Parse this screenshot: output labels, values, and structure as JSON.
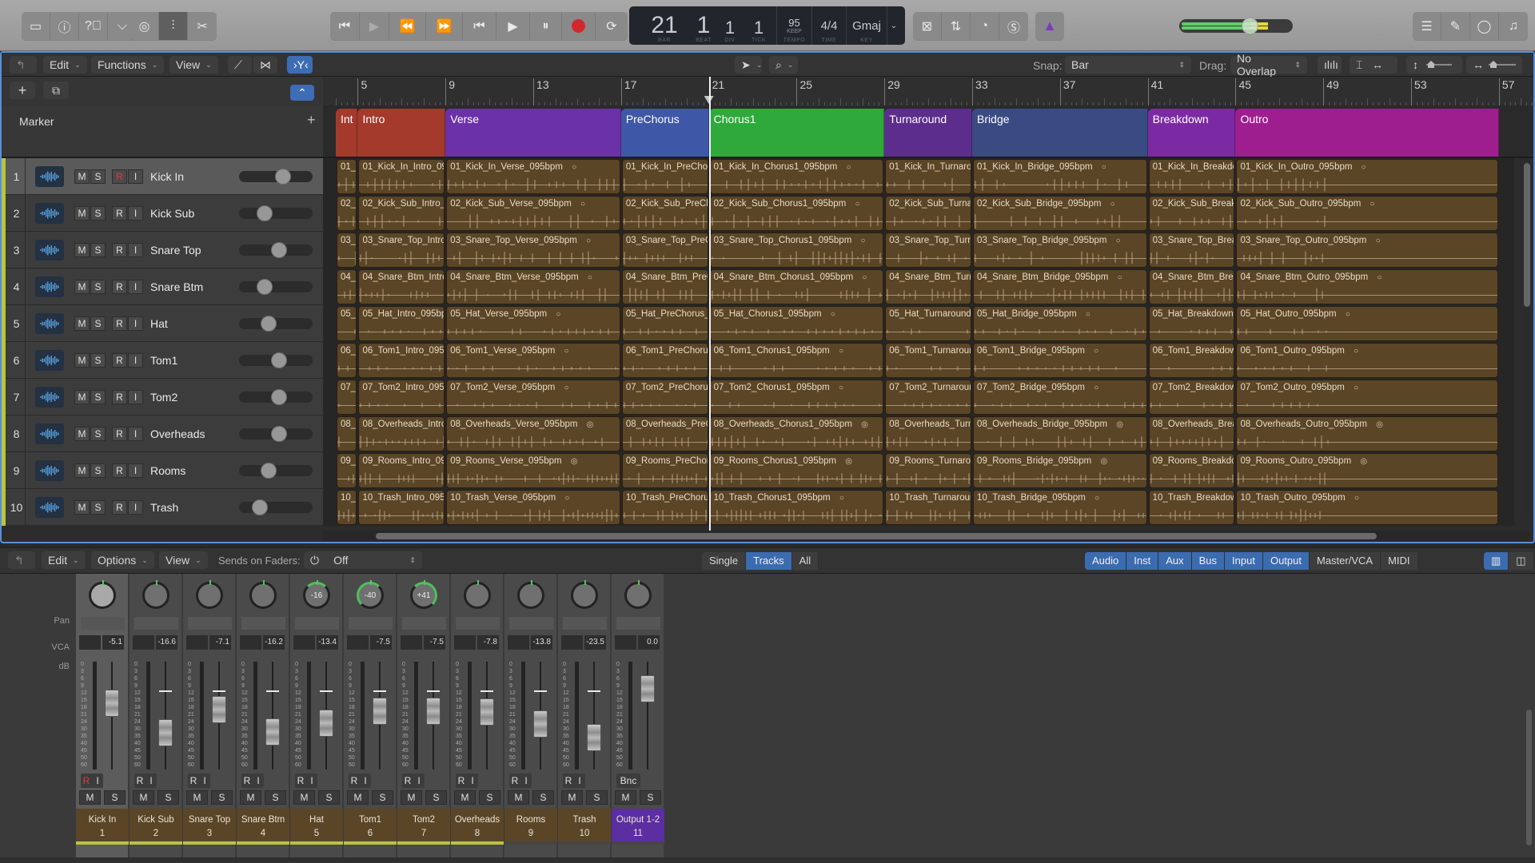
{
  "controlbar": {
    "left_buttons": [
      {
        "name": "library-icon"
      },
      {
        "name": "inspector-icon"
      },
      {
        "name": "quick-help-icon"
      },
      {
        "name": "toolbar-icon"
      }
    ],
    "view_buttons": [
      {
        "name": "smart-controls-icon"
      },
      {
        "name": "mixer-icon",
        "active": true
      },
      {
        "name": "editors-icon"
      }
    ],
    "transport": [
      {
        "name": "go-to-beginning-icon"
      },
      {
        "name": "play-from-selection-icon"
      },
      {
        "name": "rewind-icon"
      },
      {
        "name": "fast-forward-icon"
      },
      {
        "name": "go-to-previous-icon"
      },
      {
        "name": "play-icon"
      },
      {
        "name": "pause-icon"
      },
      {
        "name": "record-icon"
      },
      {
        "name": "cycle-icon"
      }
    ],
    "lcd": {
      "bar": "21",
      "bar_label": "BAR",
      "beat": "1",
      "beat_label": "BEAT",
      "div": "1",
      "div_label": "DIV",
      "tick": "1",
      "tick_label": "TICK",
      "tempo": "95",
      "tempo_mode": "KEEP",
      "tempo_label": "TEMPO",
      "time_sig": "4/4",
      "time_label": "TIME",
      "key": "Gmaj",
      "key_label": "KEY"
    },
    "right_tools": [
      {
        "name": "replace-icon"
      },
      {
        "name": "count-in-icon"
      },
      {
        "name": "tuner-icon"
      },
      {
        "name": "solo-icon"
      }
    ],
    "metronome": {
      "name": "metronome-icon"
    },
    "master_volume": {
      "level": 0.63
    },
    "far_right": [
      {
        "name": "list-editors-icon"
      },
      {
        "name": "note-pad-icon"
      },
      {
        "name": "loop-browser-icon"
      },
      {
        "name": "browser-icon"
      }
    ]
  },
  "tracks_toolbar": {
    "back_icon": "back-icon",
    "menus": [
      "Edit",
      "Functions",
      "View"
    ],
    "snap_label": "Snap:",
    "snap_value": "Bar",
    "drag_label": "Drag:",
    "drag_value": "No Overlap",
    "add_track": "+",
    "marker_label": "Marker",
    "marker_add": "+"
  },
  "ruler": {
    "bars": [
      "5",
      "9",
      "13",
      "17",
      "21",
      "25",
      "29",
      "33",
      "37",
      "41",
      "45",
      "49",
      "53",
      "57"
    ],
    "playhead_bar": 21
  },
  "markers": [
    {
      "label": "Int",
      "start": 4,
      "end": 5,
      "color": "#a33a2c"
    },
    {
      "label": "Intro",
      "start": 5,
      "end": 9,
      "color": "#a33a2c"
    },
    {
      "label": "Verse",
      "start": 9,
      "end": 17,
      "color": "#6b31a8"
    },
    {
      "label": "PreChorus",
      "start": 17,
      "end": 21,
      "color": "#3e57a6"
    },
    {
      "label": "Chorus1",
      "start": 21,
      "end": 29,
      "color": "#2fa93b"
    },
    {
      "label": "Turnaround",
      "start": 29,
      "end": 33,
      "color": "#5c2d8c"
    },
    {
      "label": "Bridge",
      "start": 33,
      "end": 41,
      "color": "#3a4a82"
    },
    {
      "label": "Breakdown",
      "start": 41,
      "end": 45,
      "color": "#7c2aa4"
    },
    {
      "label": "Outro",
      "start": 45,
      "end": 57,
      "color": "#9e1e8f"
    }
  ],
  "tracks": [
    {
      "num": "1",
      "name": "Kick In",
      "prefix": "01_Kick_In",
      "rec": true,
      "vol": 0.62,
      "selected": true,
      "loop": "O"
    },
    {
      "num": "2",
      "name": "Kick Sub",
      "prefix": "02_Kick_Sub",
      "rec": false,
      "vol": 0.3,
      "loop": "O"
    },
    {
      "num": "3",
      "name": "Snare Top",
      "prefix": "03_Snare_Top",
      "rec": false,
      "vol": 0.55,
      "loop": "O"
    },
    {
      "num": "4",
      "name": "Snare Btm",
      "prefix": "04_Snare_Btm",
      "rec": false,
      "vol": 0.3,
      "loop": "O"
    },
    {
      "num": "5",
      "name": "Hat",
      "prefix": "05_Hat",
      "rec": false,
      "vol": 0.38,
      "loop": "O"
    },
    {
      "num": "6",
      "name": "Tom1",
      "prefix": "06_Tom1",
      "rec": false,
      "vol": 0.55,
      "loop": "O"
    },
    {
      "num": "7",
      "name": "Tom2",
      "prefix": "07_Tom2",
      "rec": false,
      "vol": 0.55,
      "loop": "O"
    },
    {
      "num": "8",
      "name": "Overheads",
      "prefix": "08_Overheads",
      "rec": false,
      "vol": 0.55,
      "loop": "OO"
    },
    {
      "num": "9",
      "name": "Rooms",
      "prefix": "09_Rooms",
      "rec": false,
      "vol": 0.38,
      "loop": "OO"
    },
    {
      "num": "10",
      "name": "Trash",
      "prefix": "10_Trash",
      "rec": false,
      "vol": 0.22,
      "loop": "O"
    }
  ],
  "track_buttons": {
    "mute": "M",
    "solo": "S",
    "record": "R",
    "input": "I"
  },
  "region_sections": [
    {
      "section": "",
      "start": 4,
      "end": 5,
      "short": true
    },
    {
      "section": "Intro",
      "start": 5,
      "end": 9
    },
    {
      "section": "Verse",
      "start": 9,
      "end": 17,
      "full": true
    },
    {
      "section": "PreChorus",
      "start": 17,
      "end": 21
    },
    {
      "section": "Chorus1",
      "start": 21,
      "end": 29,
      "full": true
    },
    {
      "section": "Turnaround",
      "start": 29,
      "end": 33
    },
    {
      "section": "Bridge",
      "start": 33,
      "end": 41,
      "full": true
    },
    {
      "section": "Breakdown",
      "start": 41,
      "end": 45
    },
    {
      "section": "Outro",
      "start": 45,
      "end": 57,
      "full": true
    }
  ],
  "region_suffix": "_095bpm",
  "mixer": {
    "menus": [
      "Edit",
      "Options",
      "View"
    ],
    "sends_label": "Sends on Faders:",
    "sends_value": "Off",
    "view_modes": [
      {
        "label": "Single"
      },
      {
        "label": "Tracks",
        "on": true
      },
      {
        "label": "All"
      }
    ],
    "filters": [
      {
        "label": "Audio",
        "on": true
      },
      {
        "label": "Inst",
        "on": true
      },
      {
        "label": "Aux",
        "on": true
      },
      {
        "label": "Bus",
        "on": true
      },
      {
        "label": "Input",
        "on": true
      },
      {
        "label": "Output",
        "on": true
      },
      {
        "label": "Master/VCA"
      },
      {
        "label": "MIDI"
      }
    ],
    "row_labels": {
      "pan": "Pan",
      "vca": "VCA",
      "db": "dB"
    },
    "scale": [
      "0",
      "3",
      "6",
      "9",
      "12",
      "15",
      "18",
      "21",
      "24",
      "30",
      "35",
      "40",
      "45",
      "50",
      "60"
    ],
    "channels": [
      {
        "name": "Kick In",
        "num": "1",
        "pan": "",
        "pan_value": 0,
        "db": "-5.1",
        "fader": 0.64,
        "rec": true,
        "selected": true,
        "color": true
      },
      {
        "name": "Kick Sub",
        "num": "2",
        "pan": "",
        "pan_value": 0,
        "db": "-16.6",
        "fader": 0.33,
        "color": true
      },
      {
        "name": "Snare Top",
        "num": "3",
        "pan": "",
        "pan_value": 0,
        "db": "-7.1",
        "fader": 0.58,
        "color": true
      },
      {
        "name": "Snare Btm",
        "num": "4",
        "pan": "",
        "pan_value": 0,
        "db": "-16.2",
        "fader": 0.34,
        "color": true
      },
      {
        "name": "Hat",
        "num": "5",
        "pan": "-16",
        "pan_value": -16,
        "db": "-13.4",
        "fader": 0.43,
        "color": true
      },
      {
        "name": "Tom1",
        "num": "6",
        "pan": "-40",
        "pan_value": -40,
        "db": "-7.5",
        "fader": 0.56,
        "color": true
      },
      {
        "name": "Tom2",
        "num": "7",
        "pan": "+41",
        "pan_value": 41,
        "db": "-7.5",
        "fader": 0.56,
        "color": true
      },
      {
        "name": "Overheads",
        "num": "8",
        "pan": "",
        "pan_value": 0,
        "db": "-7.8",
        "fader": 0.55,
        "color": true
      },
      {
        "name": "Rooms",
        "num": "9",
        "pan": "",
        "pan_value": 0,
        "db": "-13.8",
        "fader": 0.42,
        "color": false
      },
      {
        "name": "Trash",
        "num": "10",
        "pan": "",
        "pan_value": 0,
        "db": "-23.5",
        "fader": 0.28,
        "color": false
      },
      {
        "name": "Output 1-2",
        "num": "11",
        "pan": "",
        "pan_value": 0,
        "db": "0.0",
        "fader": 0.8,
        "output": true,
        "bnc": "Bnc",
        "color": false
      }
    ]
  }
}
